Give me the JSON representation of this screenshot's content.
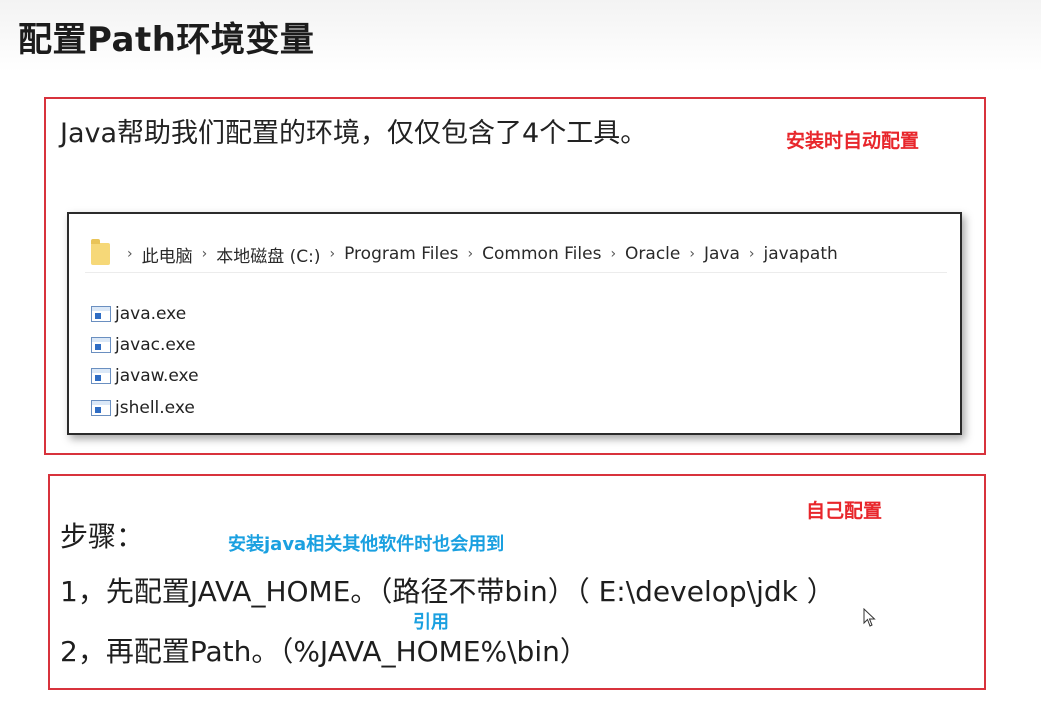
{
  "slide": {
    "title": "配置Path环境变量",
    "intro": "Java帮助我们配置的环境，仅仅包含了4个工具。",
    "note_auto": "安装时自动配置",
    "note_self": "自己配置",
    "note_reuse": "安装java相关其他软件时也会用到",
    "note_ref": "引用"
  },
  "explorer": {
    "breadcrumb": [
      "此电脑",
      "本地磁盘 (C:)",
      "Program Files",
      "Common Files",
      "Oracle",
      "Java",
      "javapath"
    ],
    "files": [
      "java.exe",
      "javac.exe",
      "javaw.exe",
      "jshell.exe"
    ]
  },
  "steps": {
    "label": "步骤：",
    "step1": "1，先配置JAVA_HOME。（路径不带bin）（ E:\\develop\\jdk ）",
    "step2": "2，再配置Path。（%JAVA_HOME%\\bin）"
  },
  "colors": {
    "box_border": "#d8323c",
    "red_note": "#e8262b",
    "blue_note": "#1aa0e0"
  }
}
